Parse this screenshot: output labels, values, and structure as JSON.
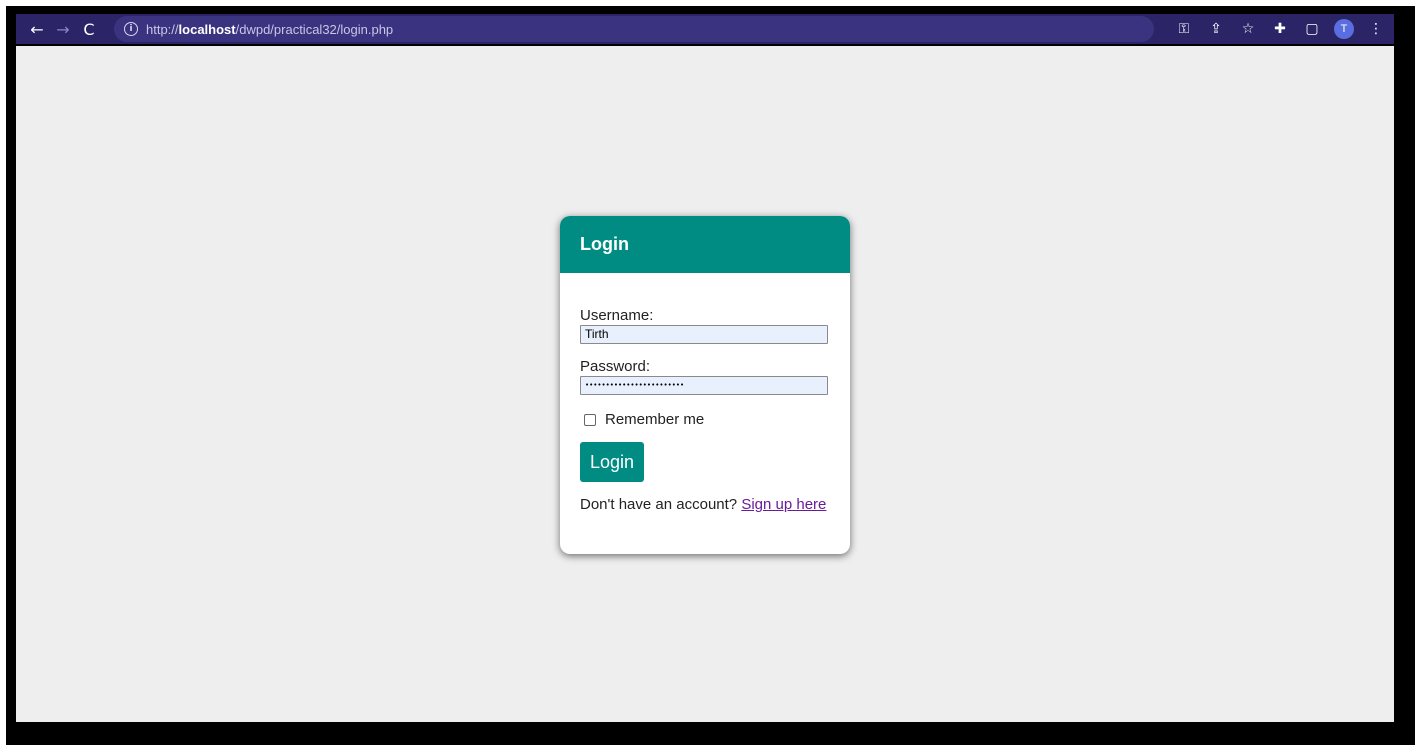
{
  "browser": {
    "url_prefix": "http://",
    "url_host": "localhost",
    "url_path": "/dwpd/practical32/login.php",
    "avatar_initial": "T",
    "bar_color": "#2b2466"
  },
  "login_card": {
    "title": "Login",
    "username_label": "Username:",
    "username_value": "Tirth",
    "password_label": "Password:",
    "password_value": "••••••••••••••••••••••••",
    "remember_label": "Remember me",
    "remember_checked": false,
    "submit_label": "Login",
    "signup_prompt": "Don't have an account?",
    "signup_link": "Sign up here",
    "accent_color": "#008b83"
  }
}
